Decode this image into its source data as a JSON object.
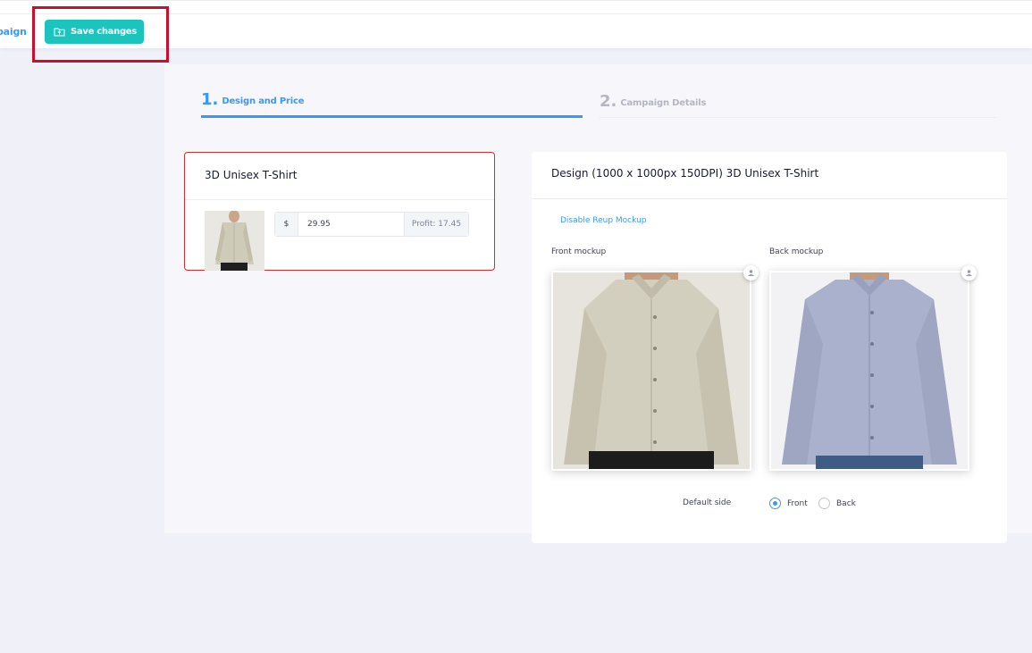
{
  "toolbar": {
    "crumb_link": "paign",
    "save_label": "Save changes"
  },
  "steps": [
    {
      "number": "1.",
      "label": "Design and Price"
    },
    {
      "number": "2.",
      "label": "Campaign Details"
    }
  ],
  "product": {
    "title": "3D Unisex T-Shirt",
    "currency": "$",
    "price": "29.95",
    "profit": "Profit: 17.45"
  },
  "design": {
    "title": "Design (1000 x 1000px 150DPI) 3D Unisex T-Shirt",
    "disable_link": "Disable Reup Mockup",
    "front_label": "Front mockup",
    "back_label": "Back mockup",
    "default_side_label": "Default side",
    "options": [
      "Front",
      "Back"
    ],
    "selected": "Front"
  },
  "colors": {
    "accent": "#3699ff",
    "save_button": "#1bc5bd",
    "highlight": "#c8102e"
  }
}
